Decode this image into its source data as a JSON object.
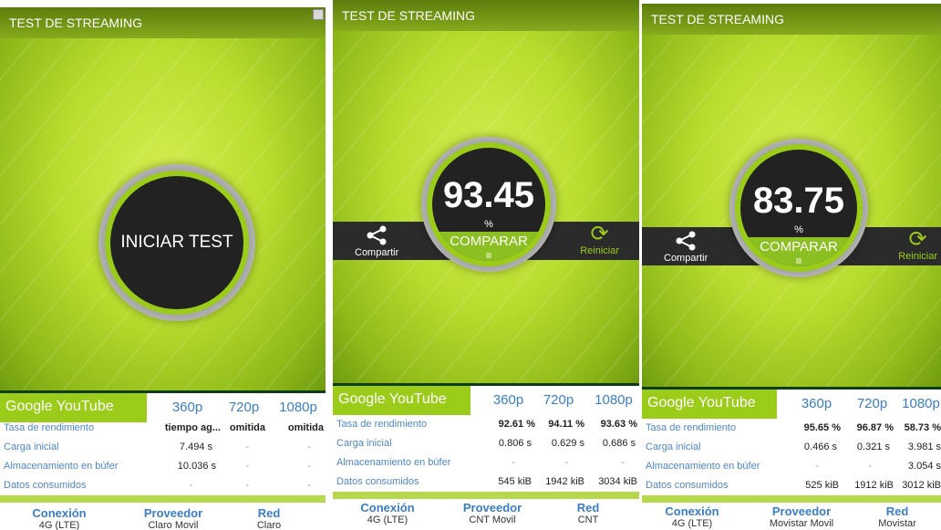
{
  "panels": [
    {
      "title": "TEST DE STREAMING",
      "start_label": "INICIAR TEST",
      "service": "Google YouTube",
      "resolutions": [
        "360p",
        "720p",
        "1080p"
      ],
      "rows": [
        {
          "label": "Tasa de rendimiento",
          "values": [
            "tiempo ag...",
            "omitida",
            "omitida"
          ]
        },
        {
          "label": "Carga inicial",
          "values": [
            "7.494 s",
            "-",
            "-"
          ]
        },
        {
          "label": "Almacenamiento en búfer",
          "values": [
            "10.036 s",
            "-",
            "-"
          ]
        },
        {
          "label": "Datos consumidos",
          "values": [
            "-",
            "-",
            "-"
          ]
        }
      ],
      "footer": {
        "connection_label": "Conexión",
        "connection_value": "4G (LTE)",
        "provider_label": "Proveedor",
        "provider_value": "Claro Movil",
        "network_label": "Red",
        "network_value": "Claro"
      }
    },
    {
      "title": "TEST DE STREAMING",
      "score": "93.45",
      "score_unit": "%",
      "compare_label": "COMPARAR",
      "share_label": "Compartir",
      "restart_label": "Reiniciar",
      "service": "Google YouTube",
      "resolutions": [
        "360p",
        "720p",
        "1080p"
      ],
      "rows": [
        {
          "label": "Tasa de rendimiento",
          "values": [
            "92.61 %",
            "94.11 %",
            "93.63 %"
          ]
        },
        {
          "label": "Carga inicial",
          "values": [
            "0.806 s",
            "0.629 s",
            "0.686 s"
          ]
        },
        {
          "label": "Almacenamiento en búfer",
          "values": [
            "-",
            "-",
            "-"
          ]
        },
        {
          "label": "Datos consumidos",
          "values": [
            "545 kiB",
            "1942 kiB",
            "3034 kiB"
          ]
        }
      ],
      "footer": {
        "connection_label": "Conexión",
        "connection_value": "4G (LTE)",
        "provider_label": "Proveedor",
        "provider_value": "CNT Movil",
        "network_label": "Red",
        "network_value": "CNT"
      }
    },
    {
      "title": "TEST DE STREAMING",
      "score": "83.75",
      "score_unit": "%",
      "compare_label": "COMPARAR",
      "share_label": "Compartir",
      "restart_label": "Reiniciar",
      "service": "Google YouTube",
      "resolutions": [
        "360p",
        "720p",
        "1080p"
      ],
      "rows": [
        {
          "label": "Tasa de rendimiento",
          "values": [
            "95.65 %",
            "96.87 %",
            "58.73 %"
          ]
        },
        {
          "label": "Carga inicial",
          "values": [
            "0.466 s",
            "0.321 s",
            "3.981 s"
          ]
        },
        {
          "label": "Almacenamiento en búfer",
          "values": [
            "-",
            "-",
            "3.054 s"
          ]
        },
        {
          "label": "Datos consumidos",
          "values": [
            "525 kiB",
            "1912 kiB",
            "3012 kiB"
          ]
        }
      ],
      "footer": {
        "connection_label": "Conexión",
        "connection_value": "4G (LTE)",
        "provider_label": "Proveedor",
        "provider_value": "Movistar Movil",
        "network_label": "Red",
        "network_value": "Movistar"
      }
    }
  ],
  "colors": {
    "accent_green": "#9ccc1a",
    "link_blue": "#3a7ec3",
    "dark": "#222222"
  },
  "icons": {
    "share": "share-icon",
    "restart": "refresh-icon",
    "compare": "compare-icon"
  }
}
